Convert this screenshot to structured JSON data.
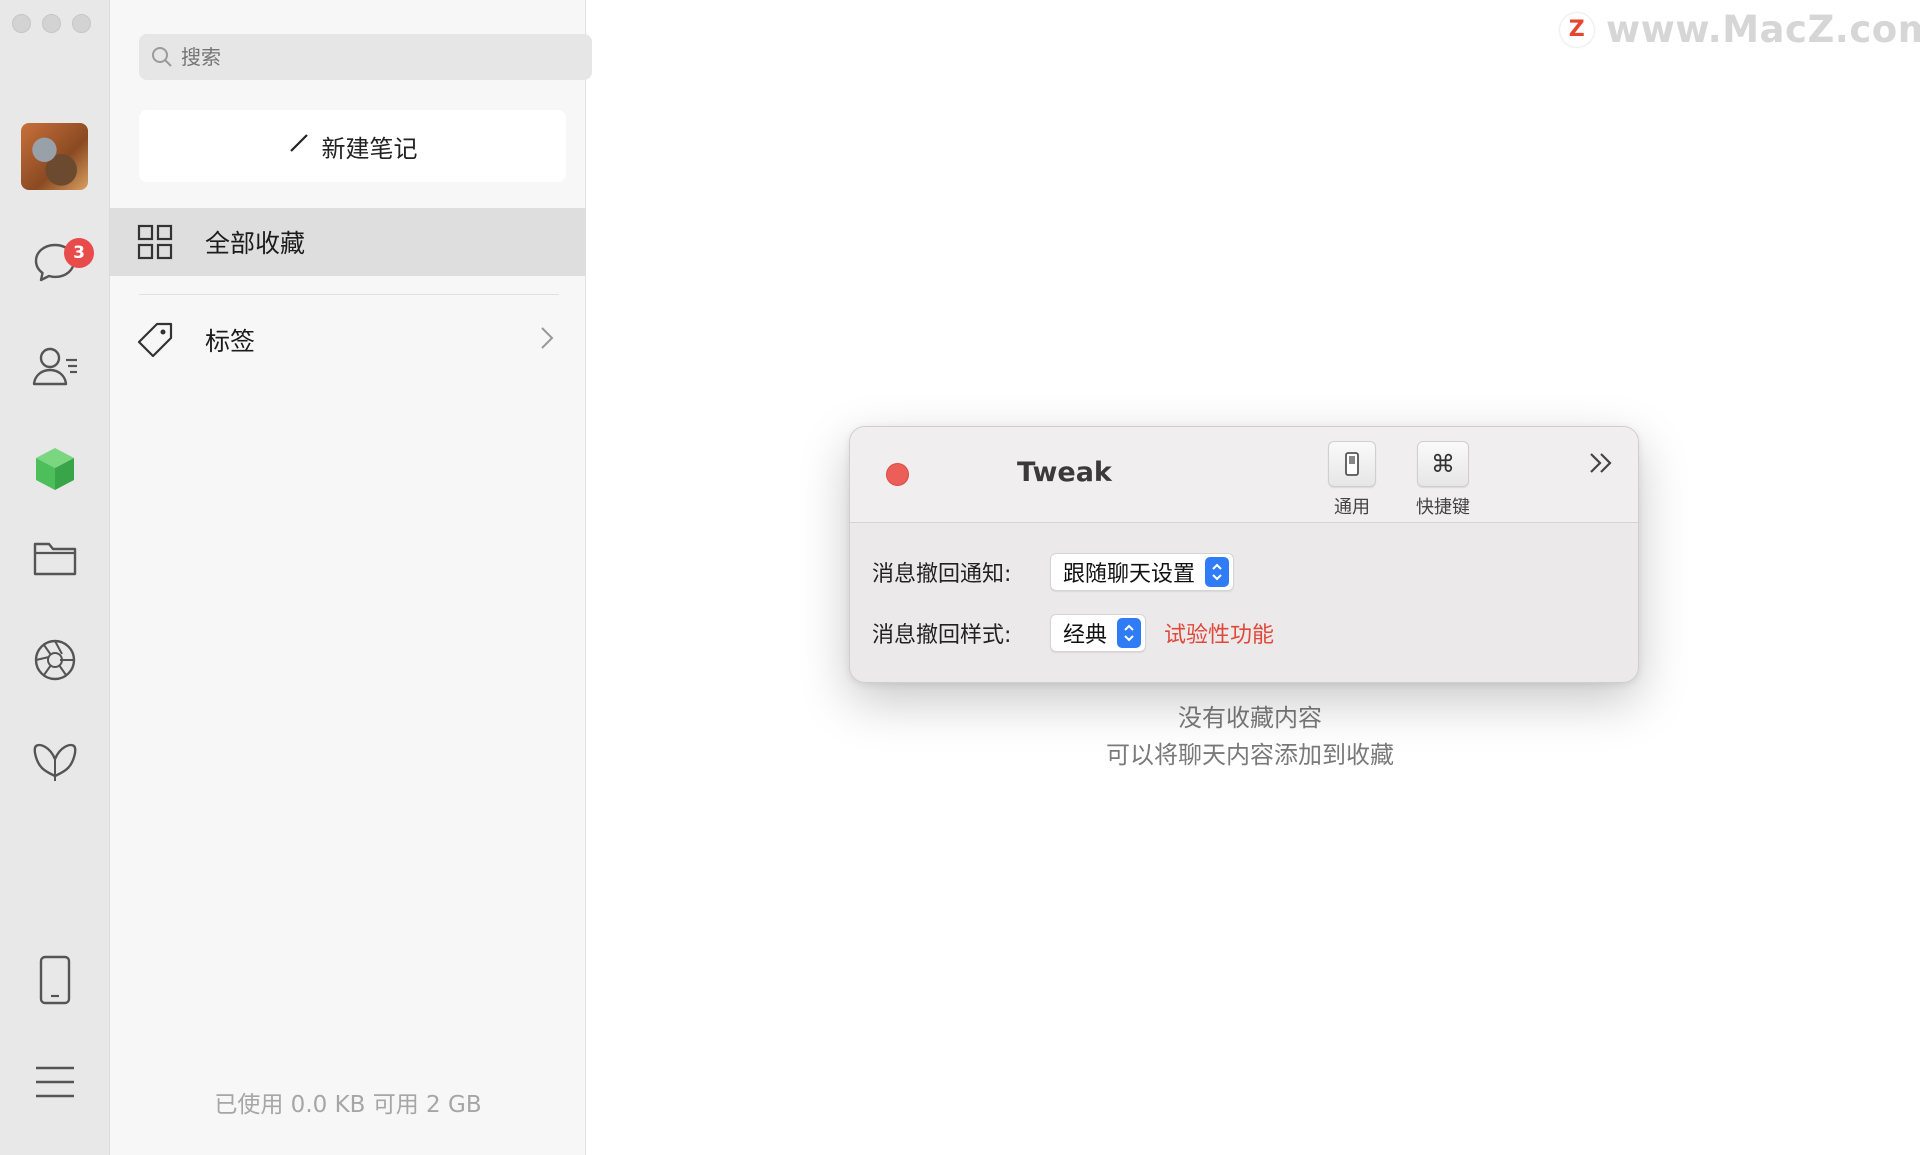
{
  "window": {
    "traffic_lights": [
      "close",
      "minimize",
      "zoom"
    ]
  },
  "rail": {
    "chat_badge": "3",
    "icons": [
      "chat-icon",
      "contacts-icon",
      "favorites-cube-icon",
      "folder-icon",
      "moments-icon",
      "mini-program-icon",
      "phone-icon",
      "menu-icon"
    ],
    "accent": "#4cbf5a"
  },
  "panel": {
    "search_placeholder": "搜索",
    "new_note_label": "新建笔记",
    "nav": [
      {
        "label": "全部收藏",
        "icon": "grid-icon",
        "active": true
      },
      {
        "label": "标签",
        "icon": "tag-icon",
        "active": false
      }
    ],
    "storage_text": "已使用 0.0 KB 可用 2 GB"
  },
  "content": {
    "empty_title": "没有收藏内容",
    "empty_subtitle": "可以将聊天内容添加到收藏"
  },
  "watermark": {
    "logo": "Z",
    "text": "www.MacZ.com"
  },
  "dialog": {
    "title": "Tweak",
    "toolbar": [
      {
        "label": "通用",
        "icon": "switch-icon"
      },
      {
        "label": "快捷键",
        "icon": "command-key-icon",
        "symbol": "⌘"
      }
    ],
    "rows": [
      {
        "label": "消息撤回通知:",
        "value": "跟随聊天设置"
      },
      {
        "label": "消息撤回样式:",
        "value": "经典",
        "note": "试验性功能"
      }
    ],
    "colors": {
      "close": "#ec5f58",
      "stepper": "#2f7cf6",
      "note": "#e0483a"
    }
  }
}
